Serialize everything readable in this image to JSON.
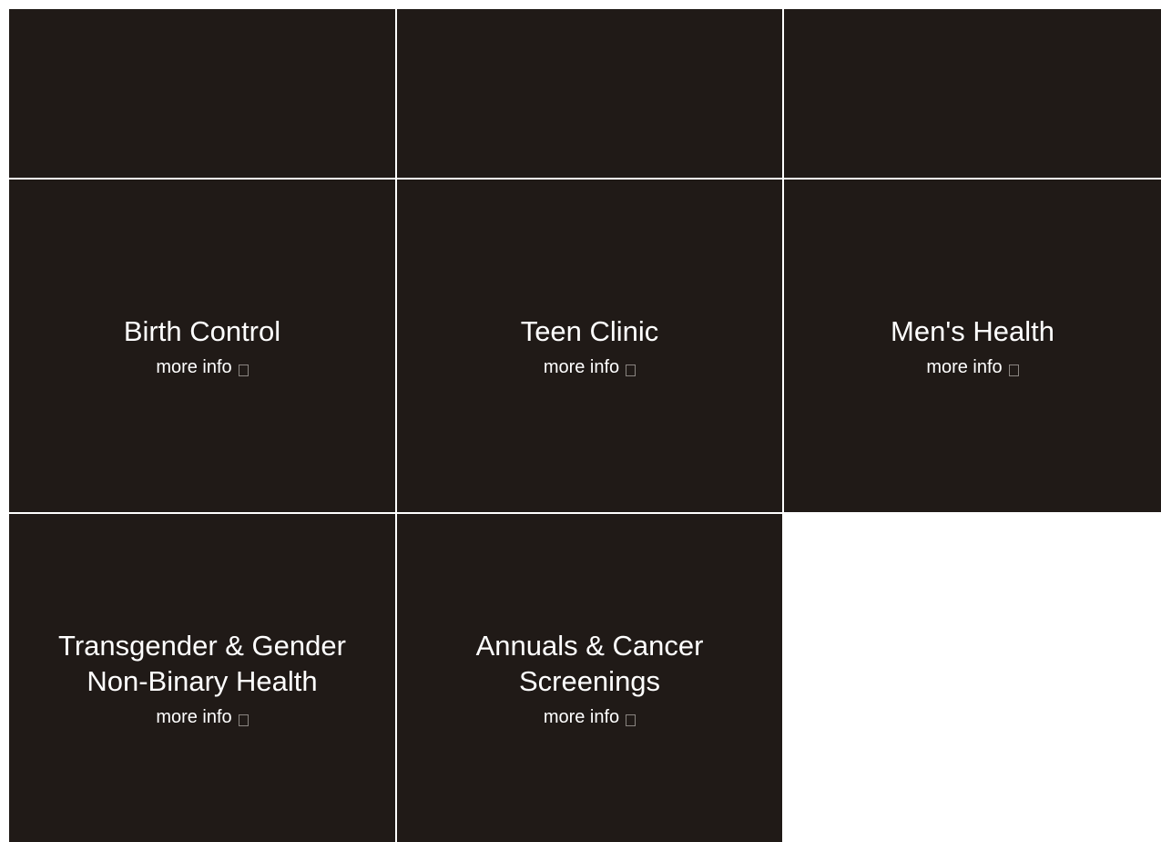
{
  "services": {
    "items": [
      {
        "title": "Birth Control",
        "link_label": "more info",
        "icon": "arrow-right-icon"
      },
      {
        "title": "Teen Clinic",
        "link_label": "more info",
        "icon": "arrow-right-icon"
      },
      {
        "title": "Men's Health",
        "link_label": "more info",
        "icon": "arrow-right-icon"
      },
      {
        "title": "Transgender & Gender Non-Binary Health",
        "link_label": "more info",
        "icon": "arrow-right-icon"
      },
      {
        "title": "Annuals & Cancer Screenings",
        "link_label": "more info",
        "icon": "arrow-right-icon"
      }
    ]
  },
  "colors": {
    "tile_background": "#201a17",
    "tile_text": "#ffffff",
    "page_background": "#ffffff"
  }
}
